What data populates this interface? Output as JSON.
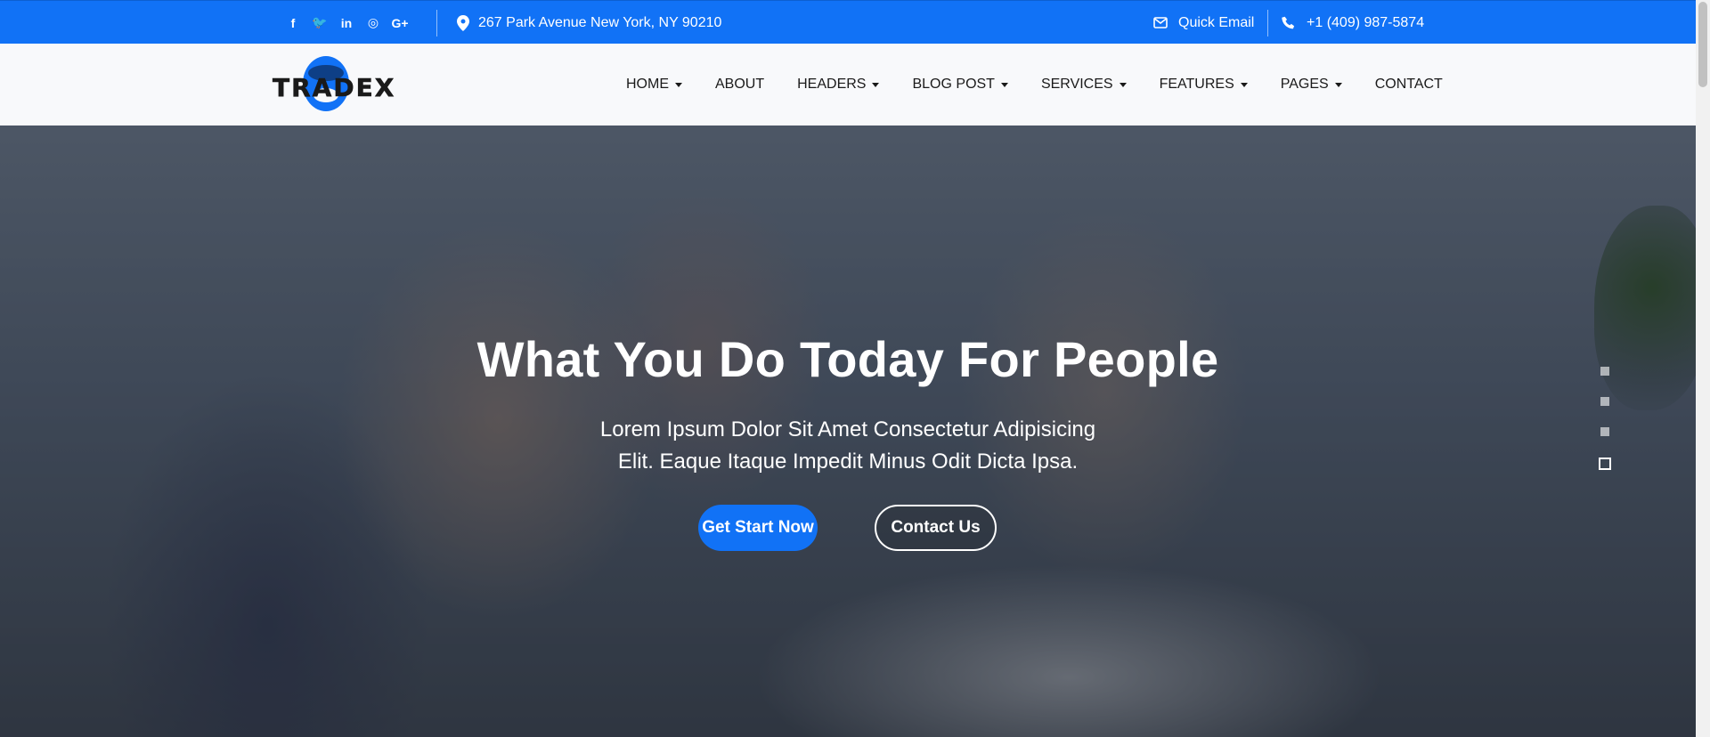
{
  "topbar": {
    "social": [
      {
        "icon": "facebook-icon",
        "glyph": "f"
      },
      {
        "icon": "twitter-icon",
        "glyph": "🐦"
      },
      {
        "icon": "linkedin-icon",
        "glyph": "in"
      },
      {
        "icon": "instagram-icon",
        "glyph": "◎"
      },
      {
        "icon": "google-plus-icon",
        "glyph": "G+"
      }
    ],
    "address": "267 Park Avenue New York, NY 90210",
    "email_label": "Quick Email",
    "phone": "+1 (409) 987-5874",
    "color": "#1172f6"
  },
  "logo": {
    "text": "TRADEX"
  },
  "nav": {
    "items": [
      {
        "label": "HOME",
        "dropdown": true
      },
      {
        "label": "ABOUT",
        "dropdown": false
      },
      {
        "label": "HEADERS",
        "dropdown": true
      },
      {
        "label": "BLOG POST",
        "dropdown": true
      },
      {
        "label": "SERVICES",
        "dropdown": true
      },
      {
        "label": "FEATURES",
        "dropdown": true
      },
      {
        "label": "PAGES",
        "dropdown": true
      },
      {
        "label": "CONTACT",
        "dropdown": false
      }
    ]
  },
  "hero": {
    "title": "What You Do Today For People",
    "subtitle_line1": "Lorem Ipsum Dolor Sit Amet Consectetur Adipisicing",
    "subtitle_line2": "Elit. Eaque Itaque Impedit Minus Odit Dicta Ipsa.",
    "primary_button": "Get Start Now",
    "secondary_button": "Contact Us",
    "slides_count": 4,
    "active_slide": 4
  }
}
